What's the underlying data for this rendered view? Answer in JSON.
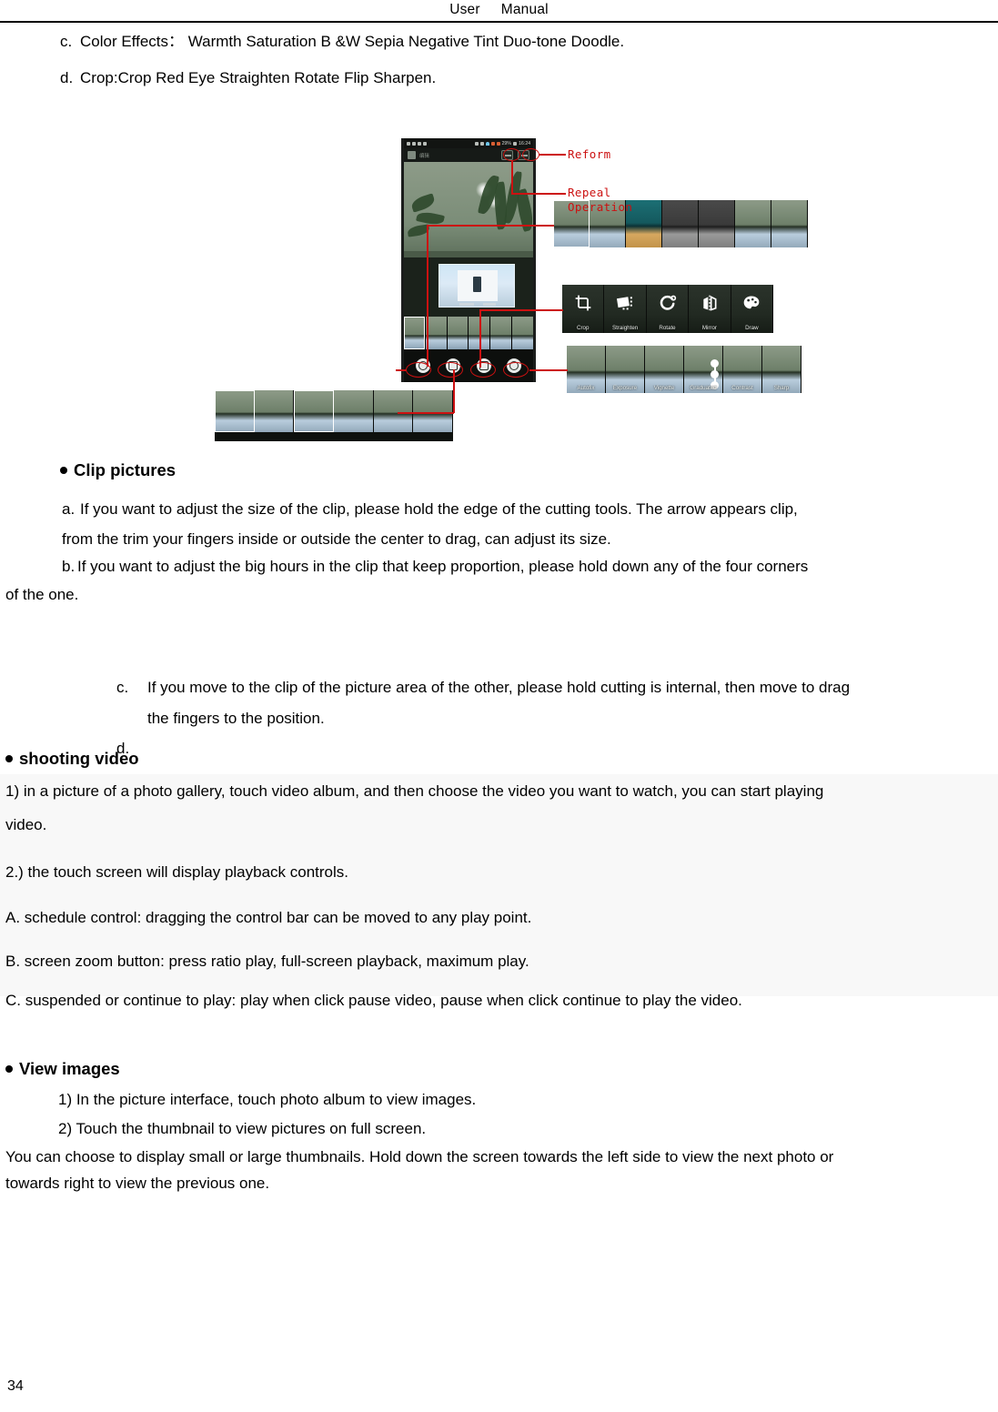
{
  "header": {
    "title_word1": "User",
    "title_word2": "Manual"
  },
  "page_number": "34",
  "top_list": [
    {
      "label": "c.",
      "text": "Color Effects： Warmth    Saturation B &W    Sepia    Negative    Tint    Duo-tone    Doodle."
    },
    {
      "label": "d.",
      "text": "Crop:Crop    Red Eye    Straighten    Rotate    Flip    Sharpen."
    }
  ],
  "figure": {
    "caption_reform": "Reform",
    "caption_repeal": "Repeal\nOperation",
    "phone": {
      "status_battery": "29%",
      "status_time": "16:24",
      "app_title": "编辑"
    },
    "tools_panel": [
      {
        "label": "Crop",
        "icon": "crop-icon"
      },
      {
        "label": "Straighten",
        "icon": "straighten-icon"
      },
      {
        "label": "Rotate",
        "icon": "rotate-icon"
      },
      {
        "label": "Mirror",
        "icon": "mirror-icon"
      },
      {
        "label": "Draw",
        "icon": "draw-palette-icon"
      }
    ],
    "adjust_panel": [
      {
        "label": "Autofix"
      },
      {
        "label": "Exposure"
      },
      {
        "label": "Vignette"
      },
      {
        "label": "Graduated"
      },
      {
        "label": "Contrast"
      },
      {
        "label": "Sharp"
      }
    ]
  },
  "clip_section": {
    "heading": "Clip pictures",
    "item_a_label": "a.",
    "item_a_line1": "If you want to adjust the size of the clip, please hold the edge of the cutting tools. The arrow appears clip,",
    "item_a_line2": "from the trim your fingers inside or outside the center to drag, can adjust its size.",
    "item_b_label": "b.",
    "item_b_line1": "If you want to adjust the big hours in the clip that keep proportion, please hold down any of the four corners",
    "item_b_line2": "of the one.",
    "item_c_label": "c.",
    "item_c_line1": "If you move to the clip of the picture area of the other, please hold cutting is internal, then move to drag",
    "item_c_line2": "the fingers to the position.",
    "item_d_label": "d.",
    "item_d_text": ""
  },
  "shooting_section": {
    "heading": "shooting video",
    "lines": [
      "1) in a picture of a photo gallery, touch video album, and then choose the video you want to watch, you can start playing",
      "video.",
      "2.) the touch screen will display playback controls.",
      "A. schedule control: dragging the control bar can be moved to any play point.",
      "B. screen zoom button: press ratio play, full-screen playback, maximum play.",
      "C. suspended or continue to play: play when click pause video, pause when click continue to play the video."
    ]
  },
  "view_section": {
    "heading": "View images",
    "item1": "1) In the picture interface, touch photo album to view images.",
    "item2": "2) Touch the thumbnail to view pictures on full screen.",
    "para_line1": "You can choose to display small or large thumbnails. Hold down the screen towards the left side to view the next photo or",
    "para_line2": "towards right to view the previous one."
  },
  "colors": {
    "annotation_red": "#cc1111",
    "highlight_bg": "#f8f8f8",
    "text": "#000000"
  }
}
